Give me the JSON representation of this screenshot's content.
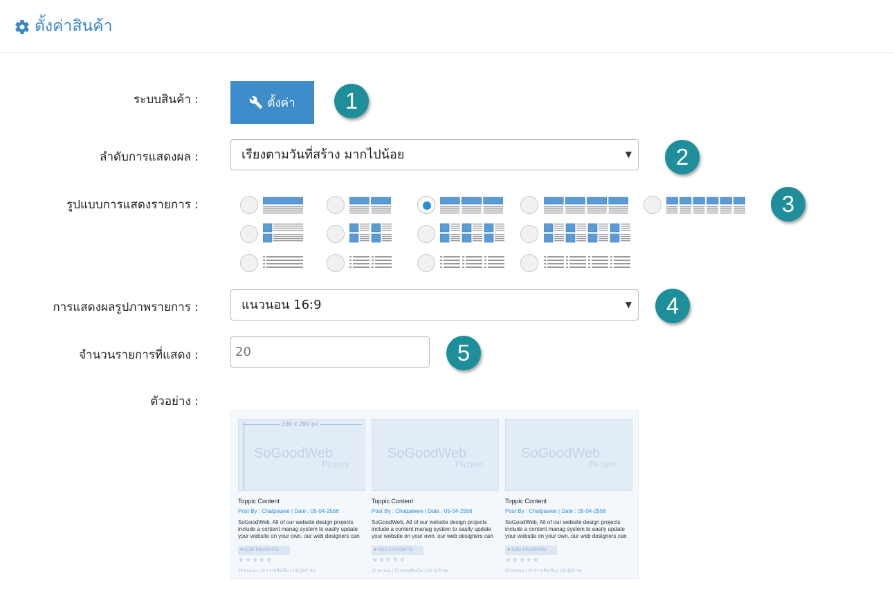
{
  "header": {
    "title": "ตั้งค่าสินค้า",
    "icon": "gear-icon",
    "accent_color": "#3a87c8"
  },
  "form": {
    "product_system": {
      "label": "ระบบสินค้า :",
      "button_label": "ตั้งค่า",
      "button_icon": "wrench-icon",
      "button_color": "#3f8ccb"
    },
    "display_order": {
      "label": "ลำดับการแสดงผล :",
      "selected": "เรียงตามวันที่สร้าง มากไปน้อย"
    },
    "list_layout": {
      "label": "รูปแบบการแสดงรายการ :",
      "rows": [
        [
          {
            "style": "grid",
            "columns": 1,
            "checked": false
          },
          {
            "style": "grid",
            "columns": 2,
            "checked": false
          },
          {
            "style": "grid",
            "columns": 3,
            "checked": true
          },
          {
            "style": "grid",
            "columns": 4,
            "checked": false
          },
          {
            "style": "grid",
            "columns": 6,
            "checked": false
          }
        ],
        [
          {
            "style": "thumb-list",
            "columns": 1,
            "checked": false
          },
          {
            "style": "thumb-list",
            "columns": 2,
            "checked": false
          },
          {
            "style": "thumb-list",
            "columns": 3,
            "checked": false
          },
          {
            "style": "thumb-list",
            "columns": 4,
            "checked": false
          }
        ],
        [
          {
            "style": "text-list",
            "columns": 1,
            "checked": false
          },
          {
            "style": "text-list",
            "columns": 2,
            "checked": false
          },
          {
            "style": "text-list",
            "columns": 3,
            "checked": false
          },
          {
            "style": "text-list",
            "columns": 4,
            "checked": false
          }
        ]
      ]
    },
    "image_display": {
      "label": "การแสดงผลรูปภาพรายการ :",
      "selected": "แนวนอน 16:9"
    },
    "item_count": {
      "label": "จำนวนรายการที่แสดง :",
      "value": "20"
    },
    "preview": {
      "label": "ตัวอย่าง :"
    }
  },
  "badges": [
    "1",
    "2",
    "3",
    "4",
    "5"
  ],
  "preview_cards": [
    {
      "dimension": "330 x 200 px",
      "brand": "SoGoodWeb",
      "brand_sub": "Picture",
      "title": "Toppic Content",
      "meta": "Post By : Chatpawee  |  Date : 05-04-2556",
      "description": "SoGoodWeb, All of our website design projects include a content manag system to easily update your website on your own. our web designers can",
      "favorite": "ADD FAVORITE",
      "stats": "20 คะแนน | 10 ความคิดเห็น | 142 ผู้เข้าชม"
    },
    {
      "dimension": "",
      "brand": "SoGoodWeb",
      "brand_sub": "Picture",
      "title": "Toppic Content",
      "meta": "Post By : Chatpawee  |  Date : 05-04-2556",
      "description": "SoGoodWeb, All of our website design projects include a content manag system to easily update your website on your own. our web designers can",
      "favorite": "ADD FAVORITE",
      "stats": "20 คะแนน | 10 ความคิดเห็น | 142 ผู้เข้าชม"
    },
    {
      "dimension": "",
      "brand": "SoGoodWeb",
      "brand_sub": "Picture",
      "title": "Toppic Content",
      "meta": "Post By : Chatpawee  |  Date : 05-04-2556",
      "description": "SoGoodWeb, All of our website design projects include a content manag system to easily update your website on your own. our web designers can",
      "favorite": "ADD FAVORITE",
      "stats": "20 คะแนน | 10 ความคิดเห็น | 142 ผู้เข้าชม"
    }
  ]
}
